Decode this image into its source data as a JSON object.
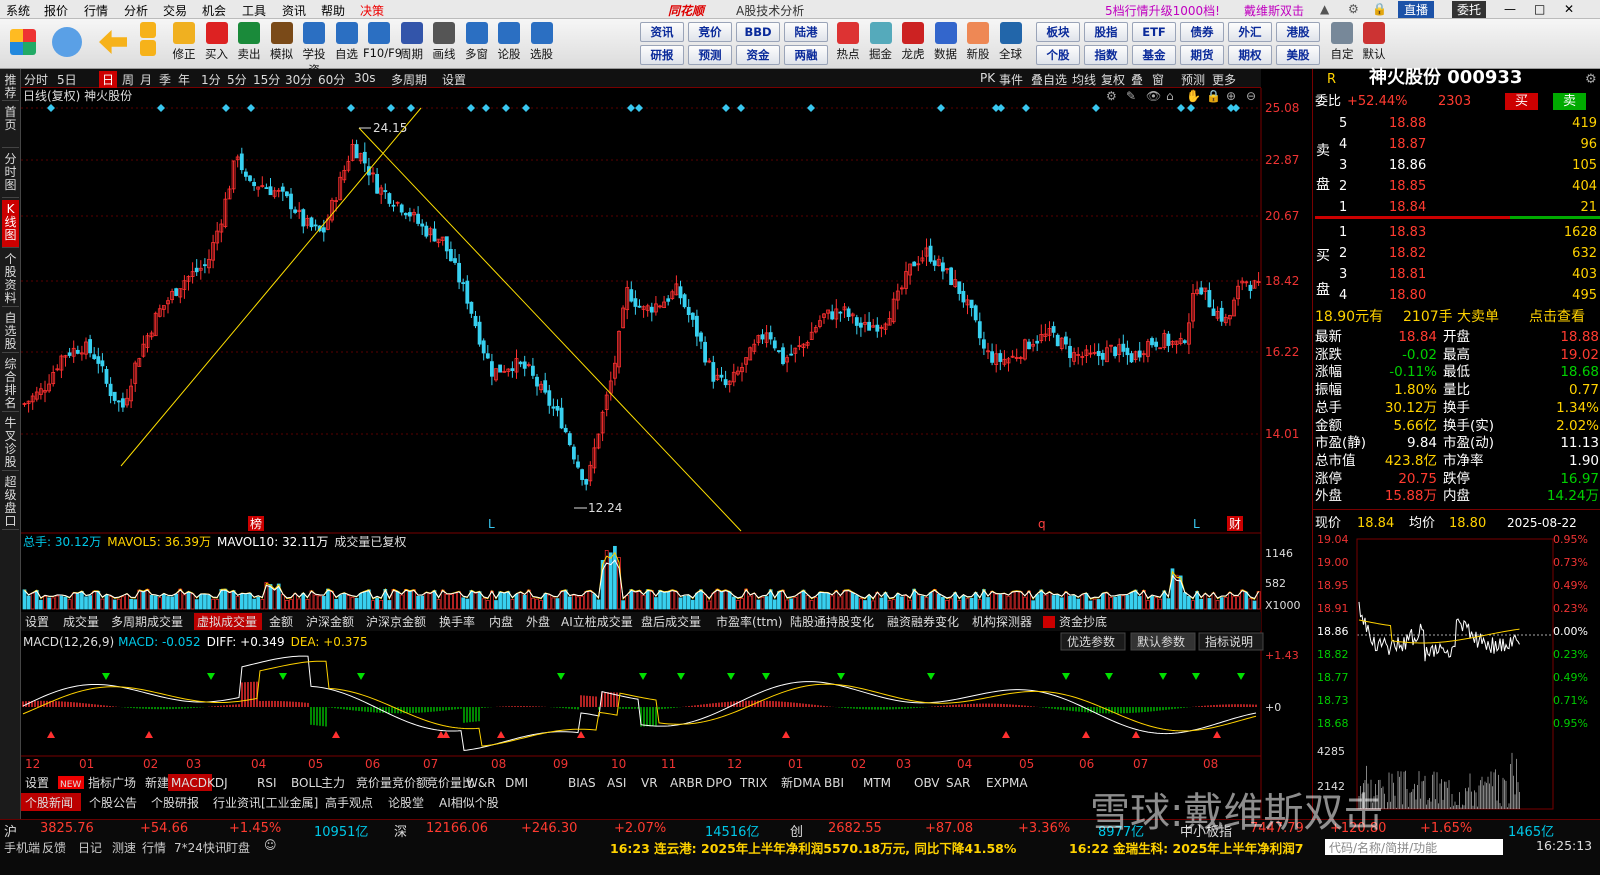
{
  "menu": {
    "items": [
      "系统",
      "报价",
      "行情",
      "分析",
      "交易",
      "机会",
      "工具",
      "资讯",
      "帮助",
      "决策"
    ],
    "brand": "同花顺",
    "title": "A股技术分析",
    "promo": "5档行情升级1000档!",
    "promo2": "戴维斯双击",
    "btn_zhitou": "直播",
    "btn_weituo": "委托"
  },
  "toolbar": {
    "tools": [
      "修正",
      "买入",
      "卖出",
      "模拟",
      "学投资",
      "自选",
      "F10/F9",
      "周期",
      "画线",
      "多窗",
      "论股",
      "选股"
    ],
    "grid": [
      [
        "资讯",
        "竞价",
        "BBD",
        "陆港"
      ],
      [
        "研报",
        "预测",
        "资金",
        "两融"
      ]
    ],
    "tools2": [
      "热点",
      "掘金",
      "龙虎",
      "数据",
      "新股",
      "全球"
    ],
    "grid2": [
      [
        "板块",
        "股指",
        "ETF",
        "债券",
        "外汇",
        "港股"
      ],
      [
        "个股",
        "指数",
        "基金",
        "期货",
        "期权",
        "美股"
      ]
    ],
    "tools3": [
      "自定",
      "默认"
    ]
  },
  "leftnav": [
    "推荐",
    "首页",
    "分时图",
    "K线图",
    "个股资料",
    "自选股",
    "综合排名",
    "牛叉诊股",
    "超级盘口"
  ],
  "period": {
    "items": [
      "分时",
      "5日",
      "日",
      "周",
      "月",
      "季",
      "年",
      "1分",
      "5分",
      "15分",
      "30分",
      "60分",
      "30s",
      "多周期",
      "设置"
    ],
    "right": [
      "PK",
      "事件",
      "叠自选",
      "均线",
      "复权",
      "叠",
      "窗",
      "预测",
      "更多"
    ]
  },
  "chart": {
    "title": "日线(复权)  神火股份",
    "y_ticks": [
      "25.08",
      "22.87",
      "20.67",
      "18.42",
      "16.22",
      "14.01"
    ],
    "high_label": "24.15",
    "low_label": "12.24",
    "markers": [
      "榜",
      "L",
      "q",
      "L",
      "财"
    ]
  },
  "volume": {
    "label": "总手: 30.12万",
    "mavol5": "MAVOL5: 36.39万",
    "mavol10": "MAVOL10: 32.11万",
    "note": "成交量已复权",
    "ticks": [
      "1146",
      "582",
      "X1000"
    ]
  },
  "indicator_tabs": [
    "设置",
    "成交量",
    "多周期成交量",
    "虚拟成交量",
    "金额",
    "沪深金额",
    "沪深京金额",
    "换手率",
    "内盘",
    "外盘",
    "AI立桩成交量",
    "盘后成交量",
    "市盈率(ttm)",
    "陆股通持股变化",
    "融资融券变化",
    "机构探测器",
    "资金抄底"
  ],
  "macd": {
    "label": "MACD(12,26,9)",
    "macd": "MACD: -0.052",
    "diff": "DIFF: +0.349",
    "dea": "DEA: +0.375",
    "ticks": [
      "+1.43",
      "+0"
    ],
    "btns": [
      "优选参数",
      "默认参数",
      "指标说明"
    ]
  },
  "xaxis": [
    "12",
    "01",
    "02",
    "03",
    "04",
    "05",
    "06",
    "07",
    "08",
    "09",
    "10",
    "11",
    "12",
    "01",
    "02",
    "03",
    "04",
    "05",
    "06",
    "07",
    "08"
  ],
  "bottom_tabs": [
    "设置",
    "NEW",
    "指标广场",
    "新建",
    "MACD",
    "KDJ",
    "RSI",
    "BOLL",
    "主力",
    "竞价量",
    "竞价额",
    "竞价量比",
    "W&R",
    "DMI",
    "BIAS",
    "ASI",
    "VR",
    "ARBR",
    "DPO",
    "TRIX",
    "新DMA",
    "BBI",
    "MTM",
    "OBV",
    "SAR",
    "EXPMA"
  ],
  "news_tabs": [
    "个股新闻",
    "个股公告",
    "个股研报",
    "行业资讯[工业金属]",
    "高手观点",
    "论股堂",
    "AI相似个股"
  ],
  "quote": {
    "name": "神火股份 000933",
    "r": "R",
    "weibi": "委比",
    "weibi_val": "+52.44%",
    "weicha": "2303",
    "buy": "买",
    "sell": "卖",
    "asks": [
      [
        "5",
        "18.88",
        "419"
      ],
      [
        "4",
        "18.87",
        "96"
      ],
      [
        "3",
        "18.86",
        "105"
      ],
      [
        "2",
        "18.85",
        "404"
      ],
      [
        "1",
        "18.84",
        "21"
      ]
    ],
    "bids": [
      [
        "1",
        "18.83",
        "1628"
      ],
      [
        "2",
        "18.82",
        "632"
      ],
      [
        "3",
        "18.81",
        "403"
      ],
      [
        "4",
        "18.80",
        "495"
      ]
    ],
    "ask_side": "卖盘",
    "bid_side": "买盘",
    "big": "18.90元有",
    "bigv": "2107手",
    "bigt": "大卖单",
    "bigl": "点击查看",
    "stats": [
      [
        "最新",
        "18.84",
        "开盘",
        "18.88"
      ],
      [
        "涨跌",
        "-0.02",
        "最高",
        "19.02"
      ],
      [
        "涨幅",
        "-0.11%",
        "最低",
        "18.68"
      ],
      [
        "振幅",
        "1.80%",
        "量比",
        "0.77"
      ],
      [
        "总手",
        "30.12万",
        "换手",
        "1.34%"
      ],
      [
        "金额",
        "5.66亿",
        "换手(实)",
        "2.02%"
      ],
      [
        "市盈(静)",
        "9.84",
        "市盈(动)",
        "11.13"
      ],
      [
        "总市值",
        "423.8亿",
        "市净率",
        "1.90"
      ],
      [
        "涨停",
        "20.75",
        "跌停",
        "16.97"
      ],
      [
        "外盘",
        "15.88万",
        "内盘",
        "14.24万"
      ]
    ],
    "now": "现价",
    "now_v": "18.84",
    "avg": "均价",
    "avg_v": "18.80",
    "date": "2025-08-22",
    "mini_left": [
      "19.04",
      "19.00",
      "18.95",
      "18.91",
      "18.86",
      "18.82",
      "18.77",
      "18.73",
      "18.68",
      "4285",
      "2142"
    ],
    "mini_right": [
      "0.95%",
      "0.73%",
      "0.49%",
      "0.23%",
      "0.00%",
      "0.23%",
      "0.49%",
      "0.71%",
      "0.95%"
    ]
  },
  "status": {
    "sh": "沪",
    "sh_v": "3825.76",
    "sh_c": "+54.66",
    "sh_p": "+1.45%",
    "sh_a": "10951亿",
    "sz": "深",
    "sz_v": "12166.06",
    "sz_c": "+246.30",
    "sz_p": "+2.07%",
    "sz_a": "14516亿",
    "cy": "创",
    "cy_v": "2682.55",
    "cy_c": "+87.08",
    "cy_p": "+3.36%",
    "cy_a": "8977亿",
    "zx": "中小板指",
    "zx_v": "7447.79",
    "zx_c": "+120.80",
    "zx_p": "+1.65%",
    "zx_a": "1465亿"
  },
  "bottombar": {
    "items": [
      "手机端",
      "反馈",
      "日记",
      "测速",
      "行情",
      "7*24快讯",
      "盯盘"
    ],
    "news1": "16:23 连云港: 2025年上半年净利润5570.18万元, 同比下降41.58%",
    "news2": "16:22 金瑞生科: 2025年上半年净利润7",
    "search": "代码/名称/简拼/功能",
    "time": "16:25:13"
  },
  "watermark": "雪球:戴维斯双击"
}
